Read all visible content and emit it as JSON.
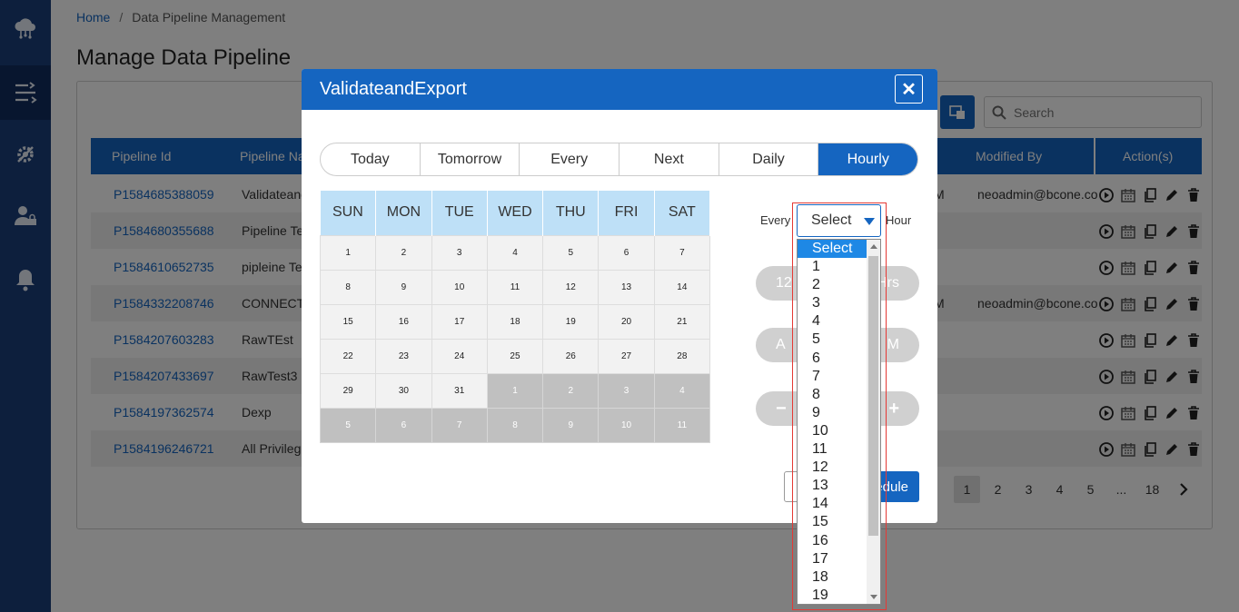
{
  "breadcrumb": {
    "home": "Home",
    "separator": "/",
    "current": "Data Pipeline Management"
  },
  "page_title": "Manage Data Pipeline",
  "search": {
    "placeholder": "Search"
  },
  "table": {
    "headers": {
      "id": "Pipeline Id",
      "name": "Pipeline Na",
      "modified_by": "Modified By",
      "actions": "Action(s)"
    },
    "rows": [
      {
        "id": "P1584685388059",
        "name": "Validateand",
        "time": "M",
        "modified_by": "neoadmin@bcone.co"
      },
      {
        "id": "P1584680355688",
        "name": "Pipeline Te",
        "time": "",
        "modified_by": ""
      },
      {
        "id": "P1584610652735",
        "name": "pipleine Te",
        "time": "",
        "modified_by": ""
      },
      {
        "id": "P1584332208746",
        "name": "CONNECTI",
        "time": "M",
        "modified_by": "neoadmin@bcone.co"
      },
      {
        "id": "P1584207603283",
        "name": "RawTEst",
        "time": "",
        "modified_by": ""
      },
      {
        "id": "P1584207433697",
        "name": "RawTest3",
        "time": "",
        "modified_by": ""
      },
      {
        "id": "P1584197362574",
        "name": "Dexp",
        "time": "",
        "modified_by": ""
      },
      {
        "id": "P1584196246721",
        "name": "All Privilege",
        "time": "",
        "modified_by": ""
      }
    ]
  },
  "pagination": {
    "pages": [
      "1",
      "2",
      "3",
      "4",
      "5",
      "...",
      "18"
    ],
    "current": "1"
  },
  "modal": {
    "title": "ValidateandExport",
    "close_glyph": "✕",
    "tabs": [
      "Today",
      "Tomorrow",
      "Every",
      "Next",
      "Daily",
      "Hourly"
    ],
    "active_tab": "Hourly",
    "calendar": {
      "days": [
        "SUN",
        "MON",
        "TUE",
        "WED",
        "THU",
        "FRI",
        "SAT"
      ],
      "weeks": [
        [
          "1",
          "2",
          "3",
          "4",
          "5",
          "6",
          "7"
        ],
        [
          "8",
          "9",
          "10",
          "11",
          "12",
          "13",
          "14"
        ],
        [
          "15",
          "16",
          "17",
          "18",
          "19",
          "20",
          "21"
        ],
        [
          "22",
          "23",
          "24",
          "25",
          "26",
          "27",
          "28"
        ],
        [
          "29",
          "30",
          "31",
          "1",
          "2",
          "3",
          "4"
        ],
        [
          "5",
          "6",
          "7",
          "8",
          "9",
          "10",
          "11"
        ]
      ]
    },
    "every_label": "Every",
    "hour_label": "Hour",
    "select_value": "Select",
    "pill_time": {
      "left": "12",
      "right": "Hrs"
    },
    "pill_ampm": {
      "left": "A",
      "right": "M"
    },
    "pill_stepper": {
      "minus": "−",
      "plus": "+"
    },
    "schedule_label": "edule"
  },
  "dropdown_options": [
    "Select",
    "1",
    "2",
    "3",
    "4",
    "5",
    "6",
    "7",
    "8",
    "9",
    "10",
    "11",
    "12",
    "13",
    "14",
    "15",
    "16",
    "17",
    "18",
    "19"
  ],
  "colors": {
    "primary": "#1565c0",
    "sidebar": "#1a3e7a",
    "calendar_header": "#bee0f7",
    "highlight_outline": "#e53935"
  }
}
